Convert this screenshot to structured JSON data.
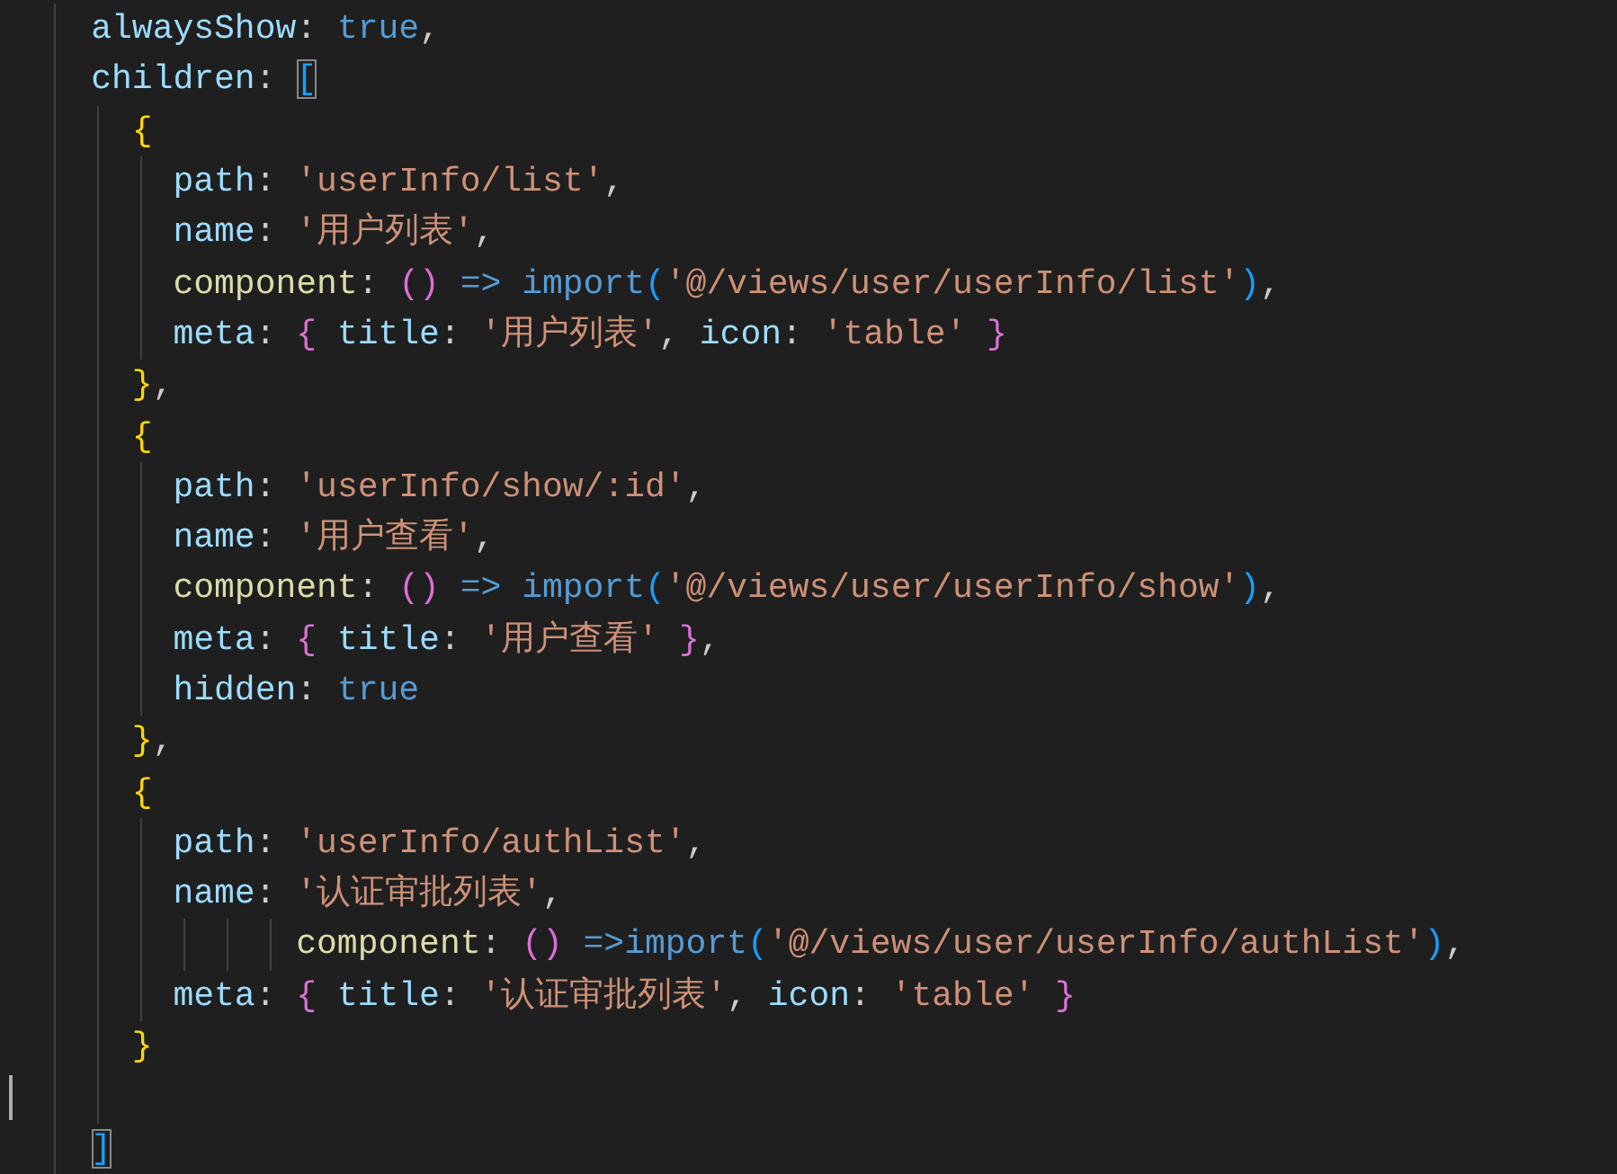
{
  "editor": {
    "lines": [
      {
        "tokens": [
          {
            "text": "    alwaysShow",
            "kind": "key"
          },
          {
            "text": ": ",
            "kind": "punct"
          },
          {
            "text": "true",
            "kind": "keyword"
          },
          {
            "text": ",",
            "kind": "punct"
          }
        ]
      },
      {
        "tokens": [
          {
            "text": "    children",
            "kind": "key"
          },
          {
            "text": ": ",
            "kind": "punct"
          },
          {
            "text": "[",
            "kind": "bracket3",
            "matched": true
          }
        ]
      },
      {
        "tokens": [
          {
            "text": "      {",
            "kind": "bracket1"
          }
        ]
      },
      {
        "tokens": [
          {
            "text": "        path",
            "kind": "key"
          },
          {
            "text": ": ",
            "kind": "punct"
          },
          {
            "text": "'userInfo/list'",
            "kind": "string"
          },
          {
            "text": ",",
            "kind": "punct"
          }
        ]
      },
      {
        "tokens": [
          {
            "text": "        name",
            "kind": "key"
          },
          {
            "text": ": ",
            "kind": "punct"
          },
          {
            "text": "'用户列表'",
            "kind": "string"
          },
          {
            "text": ",",
            "kind": "punct"
          }
        ]
      },
      {
        "tokens": [
          {
            "text": "        component",
            "kind": "func"
          },
          {
            "text": ": ",
            "kind": "punct"
          },
          {
            "text": "()",
            "kind": "bracket2"
          },
          {
            "text": " => ",
            "kind": "keyword"
          },
          {
            "text": "import",
            "kind": "keyword"
          },
          {
            "text": "(",
            "kind": "bracket3"
          },
          {
            "text": "'@/views/user/userInfo/list'",
            "kind": "string"
          },
          {
            "text": ")",
            "kind": "bracket3"
          },
          {
            "text": ",",
            "kind": "punct"
          }
        ]
      },
      {
        "tokens": [
          {
            "text": "        meta",
            "kind": "key"
          },
          {
            "text": ": ",
            "kind": "punct"
          },
          {
            "text": "{ ",
            "kind": "bracket2"
          },
          {
            "text": "title",
            "kind": "key"
          },
          {
            "text": ": ",
            "kind": "punct"
          },
          {
            "text": "'用户列表'",
            "kind": "string"
          },
          {
            "text": ", ",
            "kind": "punct"
          },
          {
            "text": "icon",
            "kind": "key"
          },
          {
            "text": ": ",
            "kind": "punct"
          },
          {
            "text": "'table'",
            "kind": "string"
          },
          {
            "text": " }",
            "kind": "bracket2"
          }
        ]
      },
      {
        "tokens": [
          {
            "text": "      }",
            "kind": "bracket1"
          },
          {
            "text": ",",
            "kind": "punct"
          }
        ]
      },
      {
        "tokens": [
          {
            "text": "      {",
            "kind": "bracket1"
          }
        ]
      },
      {
        "tokens": [
          {
            "text": "        path",
            "kind": "key"
          },
          {
            "text": ": ",
            "kind": "punct"
          },
          {
            "text": "'userInfo/show/:id'",
            "kind": "string"
          },
          {
            "text": ",",
            "kind": "punct"
          }
        ]
      },
      {
        "tokens": [
          {
            "text": "        name",
            "kind": "key"
          },
          {
            "text": ": ",
            "kind": "punct"
          },
          {
            "text": "'用户查看'",
            "kind": "string"
          },
          {
            "text": ",",
            "kind": "punct"
          }
        ]
      },
      {
        "tokens": [
          {
            "text": "        component",
            "kind": "func"
          },
          {
            "text": ": ",
            "kind": "punct"
          },
          {
            "text": "()",
            "kind": "bracket2"
          },
          {
            "text": " => ",
            "kind": "keyword"
          },
          {
            "text": "import",
            "kind": "keyword"
          },
          {
            "text": "(",
            "kind": "bracket3"
          },
          {
            "text": "'@/views/user/userInfo/show'",
            "kind": "string"
          },
          {
            "text": ")",
            "kind": "bracket3"
          },
          {
            "text": ",",
            "kind": "punct"
          }
        ]
      },
      {
        "tokens": [
          {
            "text": "        meta",
            "kind": "key"
          },
          {
            "text": ": ",
            "kind": "punct"
          },
          {
            "text": "{ ",
            "kind": "bracket2"
          },
          {
            "text": "title",
            "kind": "key"
          },
          {
            "text": ": ",
            "kind": "punct"
          },
          {
            "text": "'用户查看'",
            "kind": "string"
          },
          {
            "text": " }",
            "kind": "bracket2"
          },
          {
            "text": ",",
            "kind": "punct"
          }
        ]
      },
      {
        "tokens": [
          {
            "text": "        hidden",
            "kind": "key"
          },
          {
            "text": ": ",
            "kind": "punct"
          },
          {
            "text": "true",
            "kind": "keyword"
          }
        ]
      },
      {
        "tokens": [
          {
            "text": "      }",
            "kind": "bracket1"
          },
          {
            "text": ",",
            "kind": "punct"
          }
        ]
      },
      {
        "tokens": [
          {
            "text": "      {",
            "kind": "bracket1"
          }
        ]
      },
      {
        "tokens": [
          {
            "text": "        path",
            "kind": "key"
          },
          {
            "text": ": ",
            "kind": "punct"
          },
          {
            "text": "'userInfo/authList'",
            "kind": "string"
          },
          {
            "text": ",",
            "kind": "punct"
          }
        ]
      },
      {
        "tokens": [
          {
            "text": "        name",
            "kind": "key"
          },
          {
            "text": ": ",
            "kind": "punct"
          },
          {
            "text": "'认证审批列表'",
            "kind": "string"
          },
          {
            "text": ",",
            "kind": "punct"
          }
        ]
      },
      {
        "tokens": [
          {
            "text": "              component",
            "kind": "func"
          },
          {
            "text": ": ",
            "kind": "punct"
          },
          {
            "text": "()",
            "kind": "bracket2"
          },
          {
            "text": " =>",
            "kind": "keyword"
          },
          {
            "text": "import",
            "kind": "keyword"
          },
          {
            "text": "(",
            "kind": "bracket3"
          },
          {
            "text": "'@/views/user/userInfo/authList'",
            "kind": "string"
          },
          {
            "text": ")",
            "kind": "bracket3"
          },
          {
            "text": ",",
            "kind": "punct"
          }
        ]
      },
      {
        "tokens": [
          {
            "text": "        meta",
            "kind": "key"
          },
          {
            "text": ": ",
            "kind": "punct"
          },
          {
            "text": "{ ",
            "kind": "bracket2"
          },
          {
            "text": "title",
            "kind": "key"
          },
          {
            "text": ": ",
            "kind": "punct"
          },
          {
            "text": "'认证审批列表'",
            "kind": "string"
          },
          {
            "text": ", ",
            "kind": "punct"
          },
          {
            "text": "icon",
            "kind": "key"
          },
          {
            "text": ": ",
            "kind": "punct"
          },
          {
            "text": "'table'",
            "kind": "string"
          },
          {
            "text": " }",
            "kind": "bracket2"
          }
        ]
      },
      {
        "tokens": [
          {
            "text": "      }",
            "kind": "bracket1"
          }
        ]
      },
      {
        "current": true
      },
      {
        "tokens": [
          {
            "text": "    ]",
            "kind": "bracket3",
            "matched": true
          }
        ]
      }
    ]
  }
}
